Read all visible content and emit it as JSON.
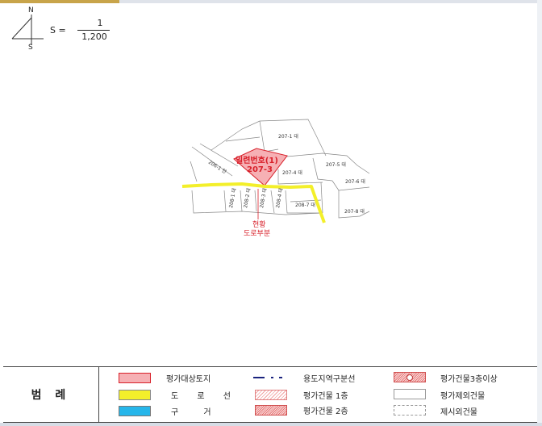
{
  "north_arrow": {
    "n": "N",
    "s": "S"
  },
  "scale": {
    "label": "S =",
    "numerator": "1",
    "denominator": "1,200"
  },
  "map": {
    "subject_label_line1": "일련번호(1)",
    "subject_label_line2": "207-3",
    "current_label_line1": "현황",
    "current_label_line2": "도로부분",
    "lots": [
      "207-1 대",
      "207-4 대",
      "207-5 대",
      "207-6 대",
      "207-8 대",
      "206-1 전",
      "208-1 대",
      "208-2 대",
      "208-3 대",
      "208-4 대",
      "208-7 대"
    ],
    "colors": {
      "subject_fill": "#f6b0b4",
      "subject_stroke": "#d8202a",
      "road": "#f3ef2a",
      "lot_line": "#888888"
    }
  },
  "legend": {
    "title": "범 례",
    "items": [
      {
        "label": "평가대상토지",
        "symbol": "pink-fill"
      },
      {
        "label": "도 로 선",
        "symbol": "yellow-fill"
      },
      {
        "label": "구 거",
        "symbol": "cyan-fill"
      },
      {
        "label": "용도지역구분선",
        "symbol": "dash-dot"
      },
      {
        "label": "평가건물 1층",
        "symbol": "hatch-light"
      },
      {
        "label": "평가건물 2층",
        "symbol": "hatch-dense"
      },
      {
        "label": "평가건물3층이상",
        "symbol": "hatch-circle"
      },
      {
        "label": "평가제외건물",
        "symbol": "outline"
      },
      {
        "label": "제시외건물",
        "symbol": "dashed-outline"
      }
    ]
  }
}
